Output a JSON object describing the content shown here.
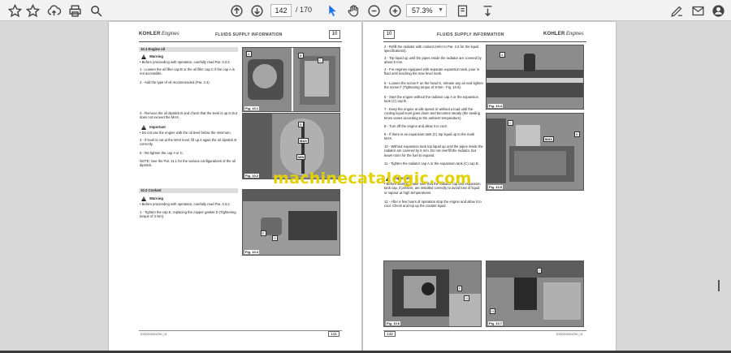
{
  "toolbar": {
    "page_current": "142",
    "page_total": "/ 170",
    "zoom": "57.3%"
  },
  "left_page": {
    "brand": "KOHLER",
    "brand_sub": "Engines",
    "title": "FLUIDS SUPPLY INFORMATION",
    "chapter": "10",
    "s1_title": "10.1 Engine oil",
    "warning": "Warning",
    "important": "Important",
    "w1": "• Before proceeding with operation, carefully read Par. 3.3.2.",
    "s1_1": "1 -   Loosen the oil filler cap B or the oil filler cap C if the cap A is not accessible.",
    "s1_2": "2 -   Add the type of oil recommended (Par. 2.4).",
    "s1_3": "3 -   Remove the oil dipstick B and check that the level is up to but does not exceed the MAX.",
    "i1": "• Do not use the engine with the oil level below the minimum.",
    "s1_4": "4 -   If level is not at the MAX level, fill up it again the oil dipstick B correctly.",
    "s1_5": "5 -   Re-tighten the cap A or C.",
    "note": "NOTE:   See the Par. 11.1 for the various configurations of the oil dipstick.",
    "s2_title": "10.2 Coolant",
    "w2": "• Before proceeding with operation, carefully read Par. 3.3.2.",
    "s2_1": "1 -   Tighten the cap E, replacing the copper gasket D (Tightening torque of 2 Nm).",
    "fig1": "Fig. 10.1",
    "fig2": "Fig. 10.2",
    "fig3": "Fig. 10.3",
    "lblA": "A",
    "lblB": "B",
    "lblC": "C",
    "lblD": "D",
    "lblE": "E",
    "lblMax": "MAX",
    "lblMin": "MIN",
    "footer_code": "ED0053031230_01",
    "footer_page": "141"
  },
  "right_page": {
    "brand": "KOHLER",
    "brand_sub": "Engines",
    "title": "FLUIDS SUPPLY INFORMATION",
    "chapter": "10",
    "r2": "2 -   Refill the radiator with coolant (refer to Par. 2.5 for the liquid specifications).",
    "r3": "3 -   Top liquid up until the pipes inside the radiator are covered by about 5 mm.",
    "r4": "4 -   For engines equipped with separate expansion tank, pour in fluid until reaching the max level mark.",
    "r5": "5 -   Loosen the screw F on the head G, release any air and tighten the screw F (Tightening torque of 8 Nm - Fig. 10.6).",
    "r6": "6 -   Start the engine without the radiator cap A or the expansion tank (C) cap B.",
    "r7": "7 -   Keep the engine at idle speed or without a load until the cooling liquid level goes down and becomes steady (the sealing times varies according to the ambient temperature).",
    "r8": "8 -   Turn off the engine and allow it to cool.",
    "r9": "9 -   If there is an expansion tank (C) top liquid up to the mark MAX.",
    "r10": "10 - Without expansion tank top liquid up until the pipes inside the radiator are covered by 5 mm. Do not overfill the radiator, but leave room for the fuel to expand.",
    "r11": "11 - Tighten the radiator cap A or the expansion tank (C) cap B.",
    "imp": "Important",
    "imp_t": "• Before starting, make sure that the radiator cap and expansion tank cap, if present, are installed correctly to avoid loss of liquid or vapour at high temperatures.",
    "r12": "12 - After a few hours of operation stop the engine and allow it to cool. Check and top up the coolant liquid.",
    "fig4": "Fig. 10.4",
    "fig5": "Fig. 10.5",
    "fig6": "Fig. 10.6",
    "fig7": "Fig. 10.7",
    "lblA": "A",
    "lblB": "B",
    "lblC": "C",
    "lblF": "F",
    "lblG": "G",
    "lblH": "H",
    "lblMax": "MAX",
    "footer_page": "142",
    "footer_code": "ED0053031230_01"
  },
  "watermark": "machinecatalogic.com"
}
